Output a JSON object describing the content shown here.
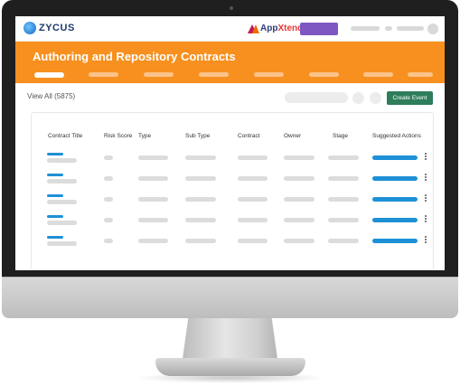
{
  "header": {
    "logo_text": "ZYCUS",
    "appxtend_prefix": "App",
    "appxtend_suffix": "Xtend"
  },
  "banner": {
    "title": "Authoring and Repository Contracts",
    "tabs": [
      "",
      "",
      "",
      "",
      "",
      "",
      "",
      ""
    ]
  },
  "toolbar": {
    "view_all_label": "View All (5875)",
    "create_event_label": "Create Event"
  },
  "table": {
    "columns": [
      "Contract Title",
      "Risk Score",
      "Type",
      "Sub Type",
      "Contract",
      "Owner",
      "Stage",
      "Suggested Actions"
    ],
    "row_count": 5
  },
  "colors": {
    "brand_orange": "#f7901e",
    "create_button": "#2e7d5b",
    "accent_blue": "#1e90d6",
    "appxtend_purple": "#7e57c2"
  }
}
